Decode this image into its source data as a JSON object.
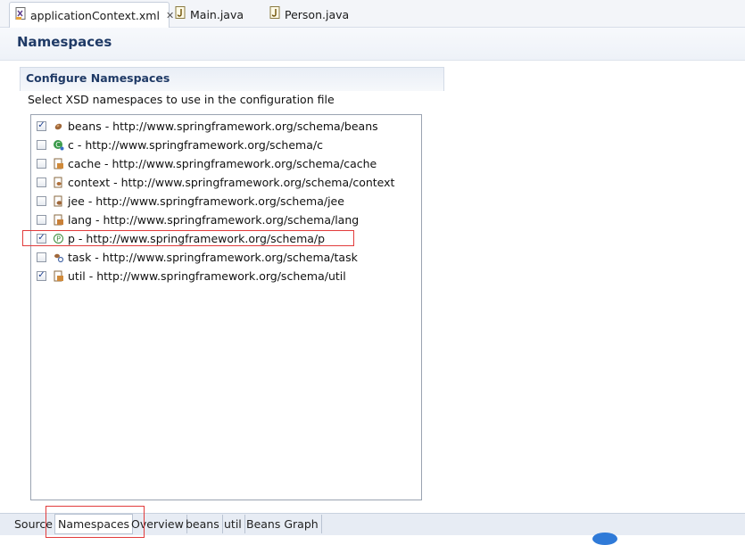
{
  "tabs": [
    {
      "label": "applicationContext.xml",
      "icon": "xml-file-icon",
      "active": true,
      "close": "✕"
    },
    {
      "label": "Main.java",
      "icon": "java-file-icon",
      "active": false
    },
    {
      "label": "Person.java",
      "icon": "java-file-icon",
      "active": false
    }
  ],
  "header": {
    "title": "Namespaces"
  },
  "section": {
    "title": "Configure Namespaces",
    "description": "Select XSD namespaces to use in the configuration file"
  },
  "namespaces": [
    {
      "label": "beans - http://www.springframework.org/schema/beans",
      "checked": true,
      "icon": "bean-icon"
    },
    {
      "label": "c - http://www.springframework.org/schema/c",
      "checked": false,
      "icon": "c-namespace-icon"
    },
    {
      "label": "cache - http://www.springframework.org/schema/cache",
      "checked": false,
      "icon": "cache-icon"
    },
    {
      "label": "context - http://www.springframework.org/schema/context",
      "checked": false,
      "icon": "context-icon"
    },
    {
      "label": "jee - http://www.springframework.org/schema/jee",
      "checked": false,
      "icon": "jee-icon"
    },
    {
      "label": "lang - http://www.springframework.org/schema/lang",
      "checked": false,
      "icon": "lang-icon"
    },
    {
      "label": "p - http://www.springframework.org/schema/p",
      "checked": true,
      "icon": "p-namespace-icon"
    },
    {
      "label": "task - http://www.springframework.org/schema/task",
      "checked": false,
      "icon": "task-icon"
    },
    {
      "label": "util - http://www.springframework.org/schema/util",
      "checked": true,
      "icon": "util-icon"
    }
  ],
  "check_mark": "✓",
  "bottom_tabs": [
    {
      "label": "Source",
      "active": false
    },
    {
      "label": "Namespaces",
      "active": true
    },
    {
      "label": "Overview",
      "active": false
    },
    {
      "label": "beans",
      "active": false
    },
    {
      "label": "util",
      "active": false
    },
    {
      "label": "Beans Graph",
      "active": false
    }
  ],
  "colors": {
    "accent_title": "#1f3a66",
    "highlight_box": "#e23c3c",
    "check": "#1d3f91"
  }
}
